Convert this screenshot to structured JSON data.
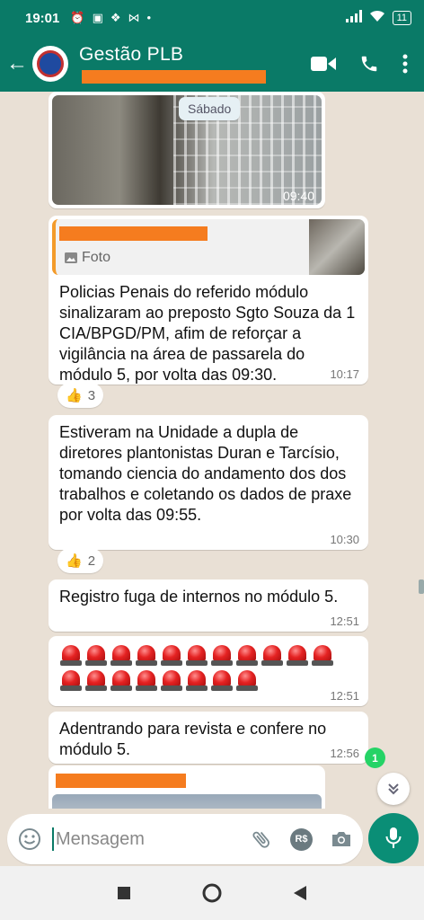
{
  "status_bar": {
    "time": "19:01",
    "battery": "11",
    "icons": [
      "alarm-icon",
      "app-notification-icon",
      "dropbox-icon",
      "network-share-icon",
      "dot-icon",
      "signal-icon",
      "wifi-icon",
      "battery-icon"
    ]
  },
  "header": {
    "title": "Gestão PLB",
    "subtitle_redacted": true,
    "actions": [
      "video-call-icon",
      "voice-call-icon",
      "more-options-icon"
    ]
  },
  "chat": {
    "day_separator": "Sábado",
    "messages": [
      {
        "type": "image",
        "time": "09:40"
      },
      {
        "type": "reply",
        "quoted_label": "Foto",
        "text": "Policias Penais do referido módulo sinalizaram ao preposto Sgto Souza da 1 CIA/BPGD/PM,  afim de reforçar a vigilância na  área de passarela do módulo 5, por volta das 09:30.",
        "time": "10:17",
        "reaction": {
          "emoji": "👍",
          "count": "3"
        }
      },
      {
        "type": "text",
        "text": "Estiveram na Unidade a dupla de diretores plantonistas Duran e Tarcísio, tomando ciencia do andamento  dos dos trabalhos e coletando os dados de praxe por volta das 09:55.",
        "time": "10:30",
        "reaction": {
          "emoji": "👍",
          "count": "2"
        }
      },
      {
        "type": "text",
        "text": "Registro fuga de internos  no módulo 5.",
        "time": "12:51"
      },
      {
        "type": "emoji",
        "emoji_name": "siren-emoji",
        "count": 19,
        "time": "12:51"
      },
      {
        "type": "text",
        "text": "Adentrando para revista e confere no módulo 5.",
        "time": "12:56"
      },
      {
        "type": "image-partial"
      }
    ],
    "unread_badge": "1"
  },
  "composer": {
    "placeholder": "Mensagem",
    "icons": [
      "emoji-icon",
      "attach-icon",
      "payment-icon",
      "camera-icon",
      "mic-icon"
    ],
    "payment_label": "R$"
  },
  "colors": {
    "header": "#0a7a67",
    "chat_bg": "#e9e0d5",
    "bubble": "#ffffff",
    "redaction": "#f57c1f",
    "accent_green": "#25d366"
  }
}
